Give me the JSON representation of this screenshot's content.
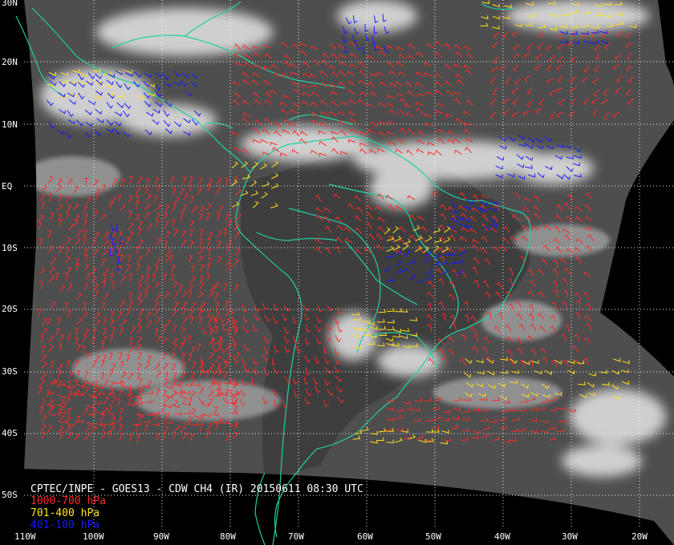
{
  "caption": "CPTEC/INPE - GOES13 - CDW CH4 (IR) 20150611 08:30 UTC",
  "legend": [
    {
      "label": "1000-700 hPa",
      "color": "#ff2a2a"
    },
    {
      "label": "701-400 hPa",
      "color": "#ffe21a"
    },
    {
      "label": "401-100 hPa",
      "color": "#1a1aff"
    }
  ],
  "lat_labels": [
    "30N",
    "20N",
    "10N",
    "EQ",
    "10S",
    "20S",
    "30S",
    "40S",
    "50S"
  ],
  "lon_labels": [
    "110W",
    "100W",
    "90W",
    "80W",
    "70W",
    "60W",
    "50W",
    "40W",
    "30W",
    "20W"
  ],
  "colors": {
    "background": "#000000",
    "coastline": "#20d0a0",
    "grid": "#ffffff",
    "cloud": "#ffffff",
    "surface": "#555555"
  }
}
